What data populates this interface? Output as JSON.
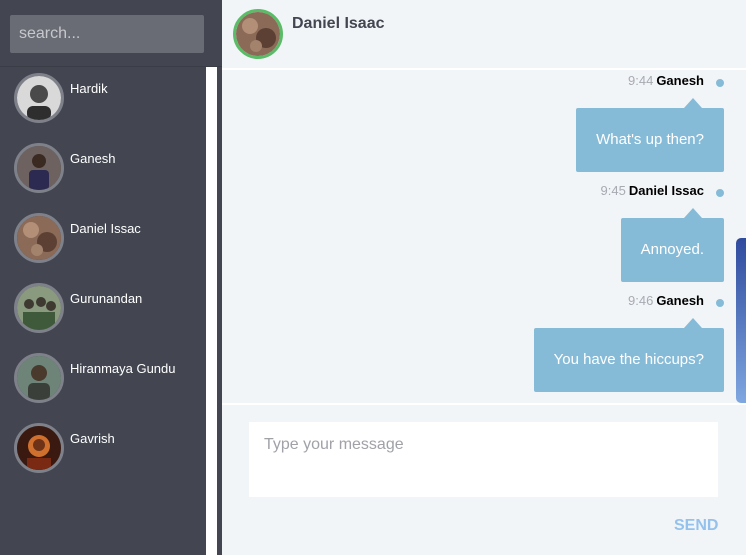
{
  "sidebar": {
    "search": {
      "placeholder": "search...",
      "value": ""
    },
    "contacts": [
      {
        "name": "Hardik",
        "avatar_color": "#cfcfcf",
        "avatar_accent": "#3a3a3a"
      },
      {
        "name": "Ganesh",
        "avatar_color": "#7a6a66",
        "avatar_accent": "#2c2a50"
      },
      {
        "name": "Daniel Issac",
        "avatar_color": "#8b6a57",
        "avatar_accent": "#4e3a2e"
      },
      {
        "name": "Gurunandan",
        "avatar_color": "#7c8a6f",
        "avatar_accent": "#3e5a3a"
      },
      {
        "name": "Hiranmaya Gundu",
        "avatar_color": "#6f8479",
        "avatar_accent": "#3b3f3a"
      },
      {
        "name": "Gavrish",
        "avatar_color": "#b65a2a",
        "avatar_accent": "#3a1a10"
      }
    ]
  },
  "chat": {
    "header": {
      "name": "Daniel Isaac",
      "avatar_color": "#8b6a57",
      "status_color": "#5bbc68"
    },
    "messages": [
      {
        "time": "9:44",
        "sender": "Ganesh",
        "text": "What's up then?"
      },
      {
        "time": "9:45",
        "sender": "Daniel Issac",
        "text": "Annoyed."
      },
      {
        "time": "9:46",
        "sender": "Ganesh",
        "text": "You have the hiccups?"
      }
    ],
    "composer": {
      "placeholder": "Type your message",
      "value": ""
    },
    "send_label": "SEND"
  },
  "colors": {
    "sidebar_bg": "#434651",
    "chat_bg": "#f2f5f8",
    "bubble": "#86bbd8",
    "send": "#94c2ed"
  }
}
